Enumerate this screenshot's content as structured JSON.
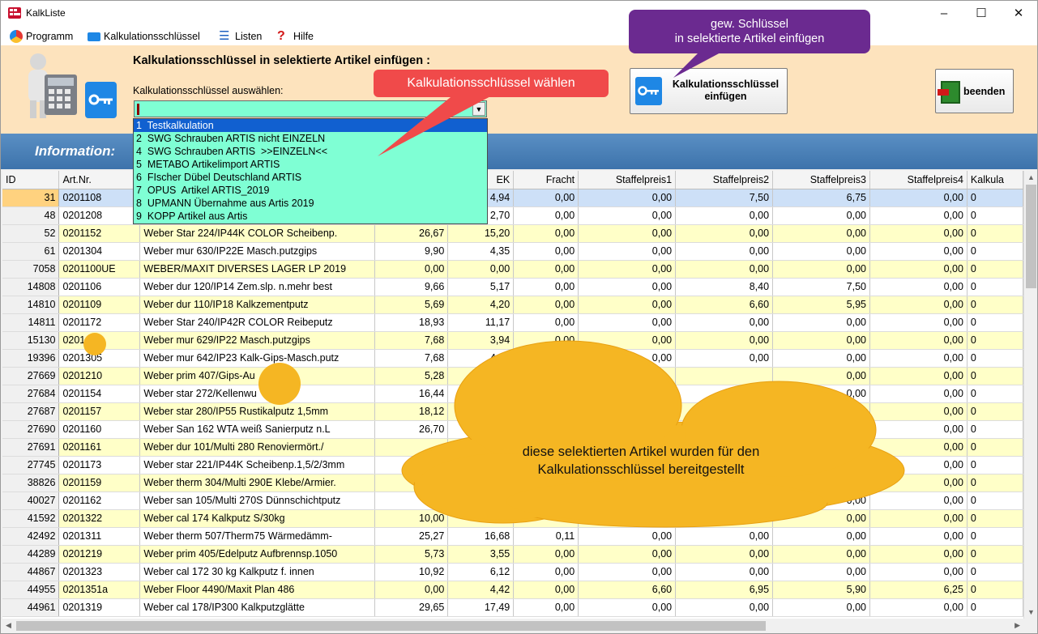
{
  "window": {
    "title": "KalkListe",
    "controls": [
      "–",
      "☐",
      "✕"
    ]
  },
  "menu": [
    {
      "label": "Programm",
      "icon": "program-icon"
    },
    {
      "label": "Kalkulationsschlüssel",
      "icon": "key-icon"
    },
    {
      "label": "Listen",
      "icon": "list-icon"
    },
    {
      "label": "Hilfe",
      "icon": "help-icon"
    }
  ],
  "panel": {
    "title": "Kalkulationsschlüssel in selektierte Artikel einfügen :",
    "combo_label": "Kalkulationsschlüssel auswählen:",
    "combo_value": "",
    "insert_button": "Kalkulationsschlüssel\neinfügen",
    "end_button": "beenden"
  },
  "info_label": "Information:",
  "dropdown": [
    "1  Testkalkulation",
    "2  SWG Schrauben ARTIS nicht EINZELN",
    "4  SWG Schrauben ARTIS  >>EINZELN<<",
    "5  METABO Artikelimport ARTIS",
    "6  FIscher Dübel Deutschland ARTIS",
    "7  OPUS  Artikel ARTIS_2019",
    "8  UPMANN Übernahme aus Artis 2019",
    "9  KOPP Artikel aus Artis"
  ],
  "dropdown_highlight": 0,
  "callouts": {
    "purple": "gew. Schlüssel\nin selektierte Artikel einfügen",
    "red": "Kalkulationsschlüssel wählen",
    "cloud": "diese selektierten Artikel wurden für den\nKalkulationsschlüssel bereitgestellt"
  },
  "table": {
    "columns": [
      "ID",
      "Art.Nr.",
      "",
      "",
      "EK",
      "Fracht",
      "Staffelpreis1",
      "Staffelpreis2",
      "Staffelpreis3",
      "Staffelpreis4",
      "Kalkula"
    ],
    "rows": [
      [
        "31",
        "0201108",
        "",
        "",
        "4,94",
        "0,00",
        "0,00",
        "7,50",
        "6,75",
        "0,00",
        "0"
      ],
      [
        "48",
        "0201208",
        "",
        "",
        "2,70",
        "0,00",
        "0,00",
        "0,00",
        "0,00",
        "0,00",
        "0"
      ],
      [
        "52",
        "0201152",
        "Weber Star 224/IP44K COLOR Scheibenp.",
        "26,67",
        "15,20",
        "0,00",
        "0,00",
        "0,00",
        "0,00",
        "0,00",
        "0"
      ],
      [
        "61",
        "0201304",
        "Weber mur 630/IP22E Masch.putzgips",
        "9,90",
        "4,35",
        "0,00",
        "0,00",
        "0,00",
        "0,00",
        "0,00",
        "0"
      ],
      [
        "7058",
        "0201100UE",
        "WEBER/MAXIT DIVERSES  LAGER  LP 2019",
        "0,00",
        "0,00",
        "0,00",
        "0,00",
        "0,00",
        "0,00",
        "0,00",
        "0"
      ],
      [
        "14808",
        "0201106",
        "Weber dur 120/IP14  Zem.slp. n.mehr best",
        "9,66",
        "5,17",
        "0,00",
        "0,00",
        "8,40",
        "7,50",
        "0,00",
        "0"
      ],
      [
        "14810",
        "0201109",
        "Weber dur 110/IP18  Kalkzementputz",
        "5,69",
        "4,20",
        "0,00",
        "0,00",
        "6,60",
        "5,95",
        "0,00",
        "0"
      ],
      [
        "14811",
        "0201172",
        "Weber Star 240/IP42R COLOR  Reibeputz",
        "18,93",
        "11,17",
        "0,00",
        "0,00",
        "0,00",
        "0,00",
        "0,00",
        "0"
      ],
      [
        "15130",
        "0201",
        "Weber mur 629/IP22 Masch.putzgips",
        "7,68",
        "3,94",
        "0,00",
        "0,00",
        "0,00",
        "0,00",
        "0,00",
        "0"
      ],
      [
        "19396",
        "0201305",
        "Weber mur 642/IP23 Kalk-Gips-Masch.putz",
        "7,68",
        "4,05",
        "0,00",
        "0,00",
        "0,00",
        "0,00",
        "0,00",
        "0"
      ],
      [
        "27669",
        "0201210",
        "Weber prim 407/Gips-Au",
        "5,28",
        "",
        "",
        "",
        "",
        "0,00",
        "0,00",
        "0"
      ],
      [
        "27684",
        "0201154",
        "Weber star 272/Kellenwu",
        "16,44",
        "",
        "",
        "",
        "",
        "0,00",
        "0,00",
        "0"
      ],
      [
        "27687",
        "0201157",
        "Weber star 280/IP55 Rustikalputz 1,5mm",
        "18,12",
        "",
        "",
        "",
        "",
        "0,00",
        "0,00",
        "0"
      ],
      [
        "27690",
        "0201160",
        "Weber San 162 WTA weiß Sanierputz n.L",
        "26,70",
        "",
        "",
        "",
        "",
        "0,00",
        "0,00",
        "0"
      ],
      [
        "27691",
        "0201161",
        "Weber dur 101/Multi 280 Renoviermört./",
        "",
        "",
        "",
        "",
        "",
        "0,00",
        "0,00",
        "0"
      ],
      [
        "27745",
        "0201173",
        "Weber star 221/IP44K Scheibenp.1,5/2/3mm",
        "",
        "",
        "",
        "",
        "",
        "0,00",
        "0,00",
        "0"
      ],
      [
        "38826",
        "0201159",
        "Weber therm 304/Multi 290E Klebe/Armier.",
        "",
        "",
        "",
        "",
        "",
        "0,00",
        "0,00",
        "0"
      ],
      [
        "40027",
        "0201162",
        "Weber san 105/Multi 270S Dünnschichtputz",
        "",
        "",
        "",
        "",
        "",
        "0,00",
        "0,00",
        "0"
      ],
      [
        "41592",
        "0201322",
        "Weber cal 174 Kalkputz S/30kg",
        "10,00",
        "",
        "",
        "",
        "",
        "0,00",
        "0,00",
        "0"
      ],
      [
        "42492",
        "0201311",
        "Weber therm 507/Therm75  Wärmedämm-",
        "25,27",
        "16,68",
        "0,11",
        "0,00",
        "0,00",
        "0,00",
        "0,00",
        "0"
      ],
      [
        "44289",
        "0201219",
        "Weber prim 405/Edelputz Aufbrennsp.1050",
        "5,73",
        "3,55",
        "0,00",
        "0,00",
        "0,00",
        "0,00",
        "0,00",
        "0"
      ],
      [
        "44867",
        "0201323",
        "Weber cal 172 30 kg Kalkputz f. innen",
        "10,92",
        "6,12",
        "0,00",
        "0,00",
        "0,00",
        "0,00",
        "0,00",
        "0"
      ],
      [
        "44955",
        "0201351a",
        "Weber Floor 4490/Maxit Plan 486",
        "0,00",
        "4,42",
        "0,00",
        "6,60",
        "6,95",
        "5,90",
        "6,25",
        "0"
      ],
      [
        "44961",
        "0201319",
        "Weber cal 178/IP300 Kalkputzglätte",
        "29,65",
        "17,49",
        "0,00",
        "0,00",
        "0,00",
        "0,00",
        "0,00",
        "0"
      ]
    ]
  }
}
